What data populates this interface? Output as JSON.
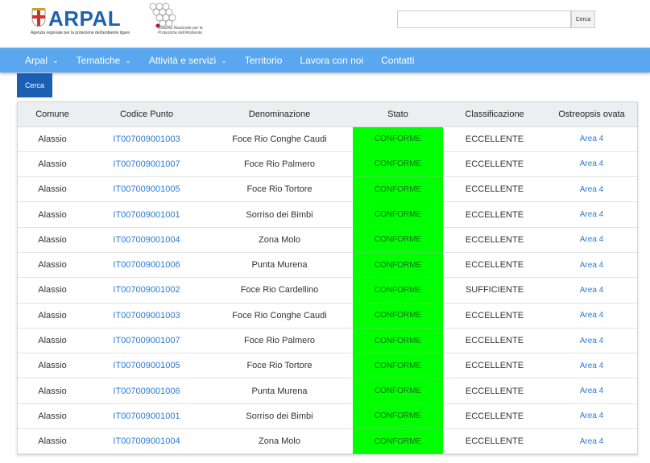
{
  "header": {
    "logo_text": "ARPAL",
    "logo_subtitle": "Agenzia regionale per la protezione dell'ambiente ligure",
    "partner_logo_text": "Sistema Nazionale per la Protezione dell'Ambiente",
    "search": {
      "placeholder": "",
      "button_label": "Cerca"
    }
  },
  "nav": {
    "items": [
      {
        "label": "Arpal",
        "has_dropdown": true
      },
      {
        "label": "Tematiche",
        "has_dropdown": true
      },
      {
        "label": "Attività e servizi",
        "has_dropdown": true
      },
      {
        "label": "Territorio",
        "has_dropdown": false
      },
      {
        "label": "Lavora con noi",
        "has_dropdown": false
      },
      {
        "label": "Contatti",
        "has_dropdown": false
      }
    ]
  },
  "tab": {
    "label": "Cerca"
  },
  "table": {
    "columns": [
      "Comune",
      "Codice Punto",
      "Denominazione",
      "Stato",
      "Classificazione",
      "Ostreopsis ovata"
    ],
    "rows": [
      [
        "Alassio",
        "IT007009001003",
        "Foce Rio Conghe Caudi",
        "CONFORME",
        "ECCELLENTE",
        "Area 4"
      ],
      [
        "Alassio",
        "IT007009001007",
        "Foce Rio Palmero",
        "CONFORME",
        "ECCELLENTE",
        "Area 4"
      ],
      [
        "Alassio",
        "IT007009001005",
        "Foce Rio Tortore",
        "CONFORME",
        "ECCELLENTE",
        "Area 4"
      ],
      [
        "Alassio",
        "IT007009001001",
        "Sorriso dei Bimbi",
        "CONFORME",
        "ECCELLENTE",
        "Area 4"
      ],
      [
        "Alassio",
        "IT007009001004",
        "Zona Molo",
        "CONFORME",
        "ECCELLENTE",
        "Area 4"
      ],
      [
        "Alassio",
        "IT007009001006",
        "Punta Murena",
        "CONFORME",
        "ECCELLENTE",
        "Area 4"
      ],
      [
        "Alassio",
        "IT007009001002",
        "Foce Rio Cardellino",
        "CONFORME",
        "SUFFICIENTE",
        "Area 4"
      ],
      [
        "Alassio",
        "IT007009001003",
        "Foce Rio Conghe Caudi",
        "CONFORME",
        "ECCELLENTE",
        "Area 4"
      ],
      [
        "Alassio",
        "IT007009001007",
        "Foce Rio Palmero",
        "CONFORME",
        "ECCELLENTE",
        "Area 4"
      ],
      [
        "Alassio",
        "IT007009001005",
        "Foce Rio Tortore",
        "CONFORME",
        "ECCELLENTE",
        "Area 4"
      ],
      [
        "Alassio",
        "IT007009001006",
        "Punta Murena",
        "CONFORME",
        "ECCELLENTE",
        "Area 4"
      ],
      [
        "Alassio",
        "IT007009001001",
        "Sorriso dei Bimbi",
        "CONFORME",
        "ECCELLENTE",
        "Area 4"
      ],
      [
        "Alassio",
        "IT007009001004",
        "Zona Molo",
        "CONFORME",
        "ECCELLENTE",
        "Area 4"
      ]
    ]
  },
  "colors": {
    "nav_bg": "#5aa7ef",
    "tab_bg": "#1b5fb4",
    "conforme_bg": "#00ff00",
    "link": "#2a7ad6",
    "logo": "#1f62b0"
  }
}
